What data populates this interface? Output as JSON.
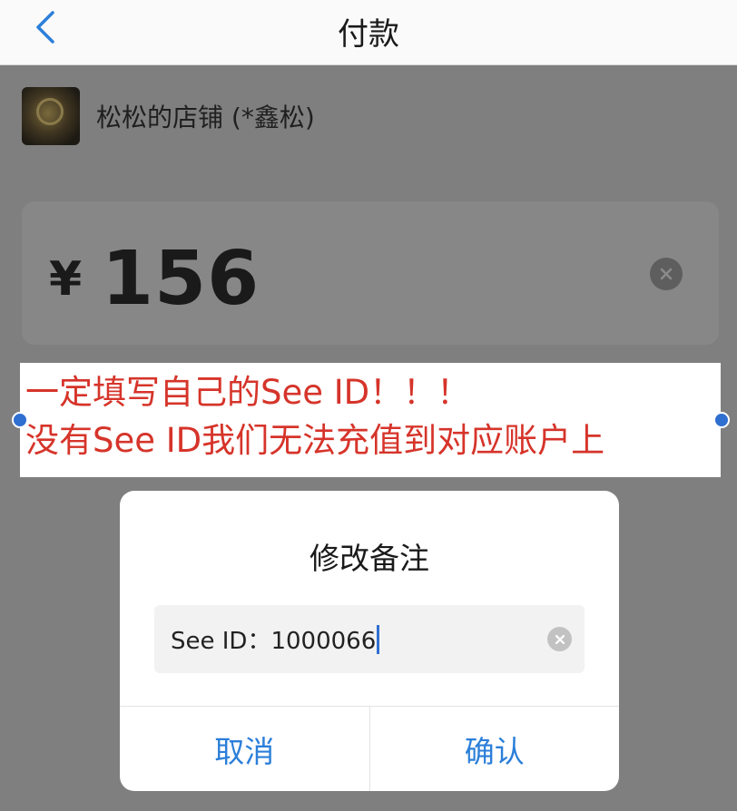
{
  "nav": {
    "title": "付款",
    "back_icon": "chevron-left-icon"
  },
  "shop": {
    "name": "松松的店铺 (*鑫松)"
  },
  "payment": {
    "currency_symbol": "¥",
    "amount": "156"
  },
  "annotation": {
    "line1": "一定填写自己的See ID！！！",
    "line2": "没有See ID我们无法充值到对应账户上",
    "text_color": "#d6342a"
  },
  "dialog": {
    "title": "修改备注",
    "input_value": "See ID：1000066",
    "cancel_label": "取消",
    "confirm_label": "确认"
  },
  "colors": {
    "accent": "#2b7fd9",
    "overlay": "#7f7f7f"
  }
}
